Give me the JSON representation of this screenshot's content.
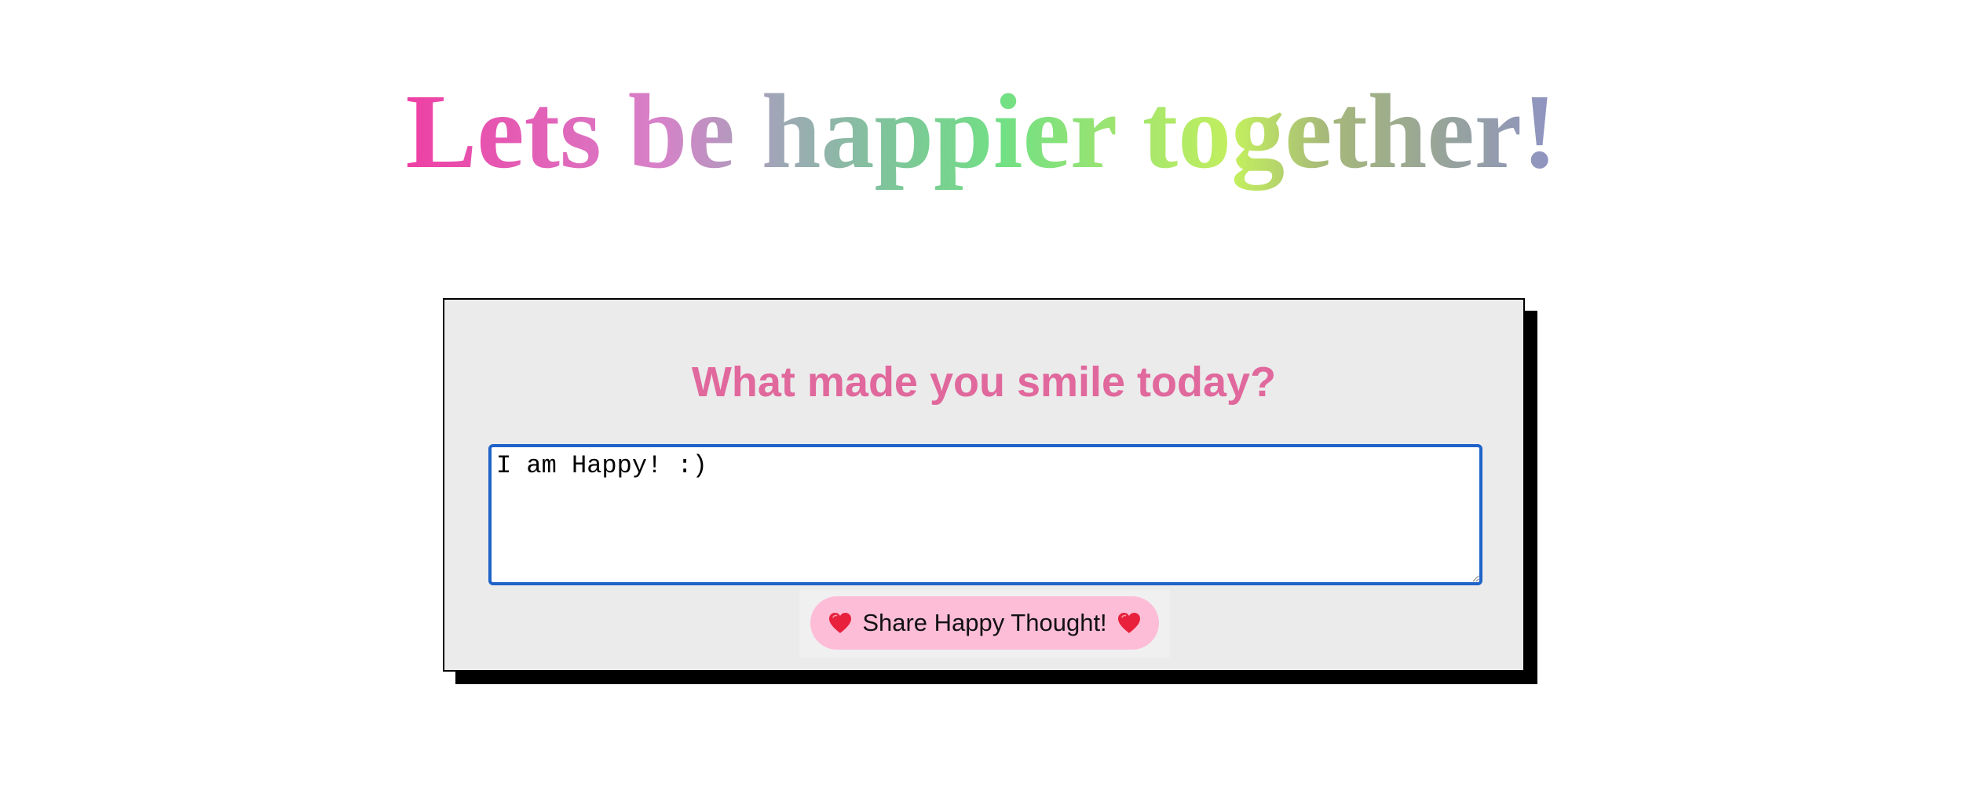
{
  "hero": {
    "title": "Lets be happier together!"
  },
  "card": {
    "heading": "What made you smile today?",
    "textarea_value": "I am Happy! :)",
    "share_button_label": "Share Happy Thought!",
    "button_icon": "heart-icon"
  },
  "colors": {
    "heading_pink": "#e0689c",
    "button_pink": "#fdbdd7",
    "card_background": "#ebebeb",
    "input_border_blue": "#1f63c9",
    "heart_red": "#e8203c"
  }
}
